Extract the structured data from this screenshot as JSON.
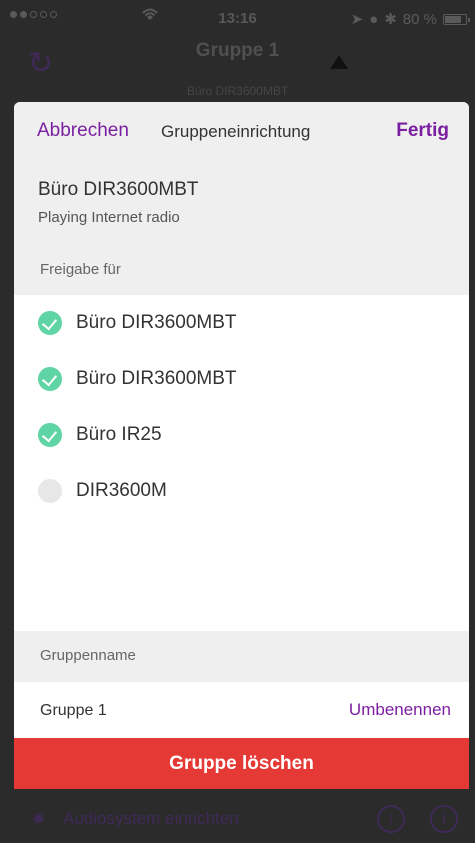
{
  "status_bar": {
    "time": "13:16",
    "battery": "80 %"
  },
  "background": {
    "group_title": "Gruppe 1",
    "group_subtitle": "Büro DIR3600MBT"
  },
  "nav": {
    "cancel_label": "Abbrechen",
    "title": "Gruppeneinrichtung",
    "done_label": "Fertig"
  },
  "device": {
    "name": "Büro DIR3600MBT",
    "state": "Playing Internet radio",
    "share_section_label": "Freigabe für"
  },
  "share_list": [
    {
      "label": "Büro DIR3600MBT",
      "checked": true
    },
    {
      "label": "Büro DIR3600MBT",
      "checked": true
    },
    {
      "label": "Büro IR25",
      "checked": true
    },
    {
      "label": "DIR3600M",
      "checked": false
    }
  ],
  "group_name": {
    "section_label": "Gruppenname",
    "value": "Gruppe 1",
    "rename_label": "Umbenennen"
  },
  "delete_label": "Gruppe löschen",
  "toolbar": {
    "setup_label": "Audiosystem einrichten"
  },
  "colors": {
    "accent": "#7b1fa2",
    "check_on": "#5fd4a5",
    "delete": "#e53935"
  }
}
